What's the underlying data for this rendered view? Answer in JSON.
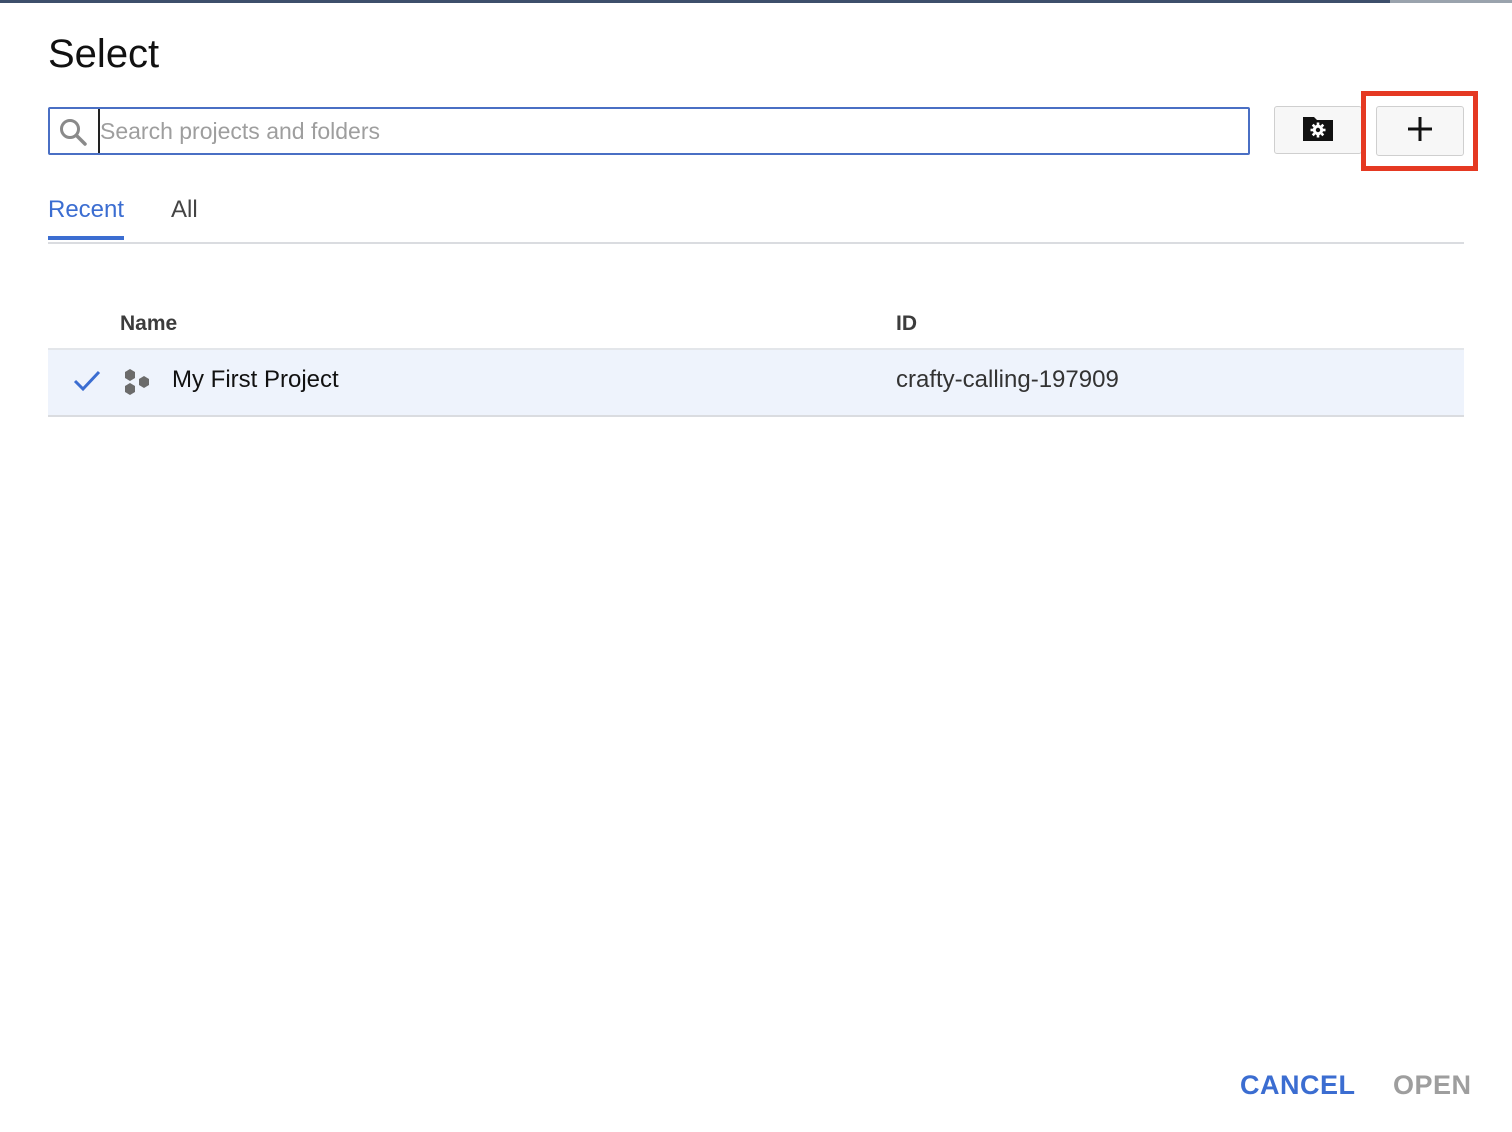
{
  "dialog": {
    "title": "Select"
  },
  "search": {
    "placeholder": "Search projects and folders",
    "value": ""
  },
  "toolbar": {
    "folder_settings_icon": "folder-gear-icon",
    "add_icon": "plus-icon",
    "add_glyph": "+"
  },
  "tabs": [
    {
      "label": "Recent",
      "active": true
    },
    {
      "label": "All",
      "active": false
    }
  ],
  "table": {
    "columns": [
      "Name",
      "ID"
    ],
    "rows": [
      {
        "selected": true,
        "name": "My First Project",
        "id": "crafty-calling-197909"
      }
    ]
  },
  "footer": {
    "cancel_label": "CANCEL",
    "open_label": "OPEN"
  },
  "colors": {
    "accent": "#3b6dd1",
    "highlight": "#e53922",
    "selected_row": "#eef3fc",
    "disabled": "#9e9e9e"
  }
}
